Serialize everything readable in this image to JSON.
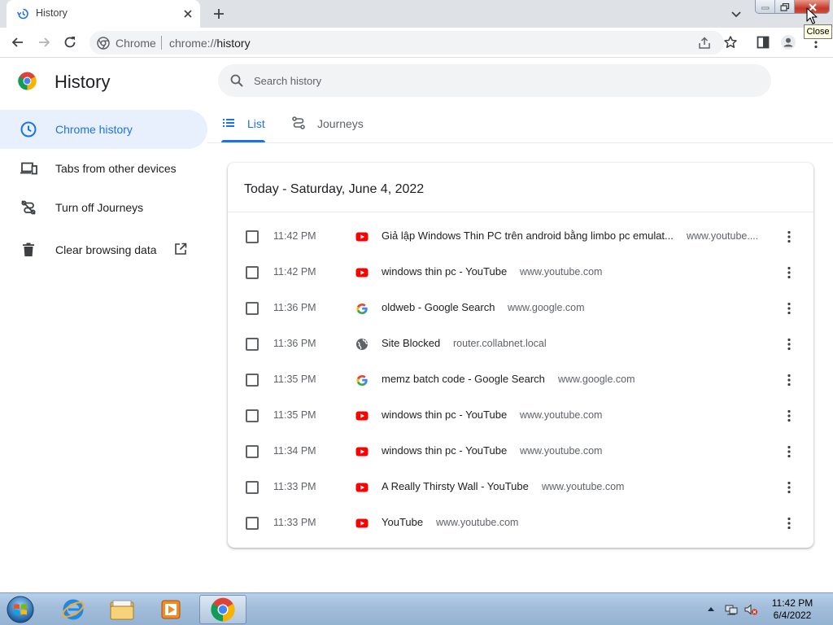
{
  "browser": {
    "tab_title": "History",
    "tooltip": "Close",
    "omnibox": {
      "site_label": "Chrome",
      "url_scheme": "chrome://",
      "url_path": "history"
    }
  },
  "page": {
    "title": "History",
    "search_placeholder": "Search history"
  },
  "sidebar": {
    "items": [
      {
        "label": "Chrome history",
        "icon": "clock-icon",
        "active": true
      },
      {
        "label": "Tabs from other devices",
        "icon": "devices-icon",
        "active": false
      },
      {
        "label": "Turn off Journeys",
        "icon": "journeys-off-icon",
        "active": false
      },
      {
        "label": "Clear browsing data",
        "icon": "trash-icon",
        "active": false
      }
    ]
  },
  "tabs": [
    {
      "label": "List",
      "icon": "list-icon",
      "active": true
    },
    {
      "label": "Journeys",
      "icon": "journeys-icon",
      "active": false
    }
  ],
  "history": {
    "date_header": "Today - Saturday, June 4, 2022",
    "entries": [
      {
        "time": "11:42 PM",
        "title": "Giả lập Windows Thin PC trên android bằng limbo pc emulat...",
        "domain": "www.youtube....",
        "favicon": "youtube-icon"
      },
      {
        "time": "11:42 PM",
        "title": "windows thin pc - YouTube",
        "domain": "www.youtube.com",
        "favicon": "youtube-icon"
      },
      {
        "time": "11:36 PM",
        "title": "oldweb - Google Search",
        "domain": "www.google.com",
        "favicon": "google-icon"
      },
      {
        "time": "11:36 PM",
        "title": "Site Blocked",
        "domain": "router.collabnet.local",
        "favicon": "globe-icon"
      },
      {
        "time": "11:35 PM",
        "title": "memz batch code - Google Search",
        "domain": "www.google.com",
        "favicon": "google-icon"
      },
      {
        "time": "11:35 PM",
        "title": "windows thin pc - YouTube",
        "domain": "www.youtube.com",
        "favicon": "youtube-icon"
      },
      {
        "time": "11:34 PM",
        "title": "windows thin pc - YouTube",
        "domain": "www.youtube.com",
        "favicon": "youtube-icon"
      },
      {
        "time": "11:33 PM",
        "title": "A Really Thirsty Wall - YouTube",
        "domain": "www.youtube.com",
        "favicon": "youtube-icon"
      },
      {
        "time": "11:33 PM",
        "title": "YouTube",
        "domain": "www.youtube.com",
        "favicon": "youtube-icon"
      }
    ]
  },
  "taskbar": {
    "clock_time": "11:42 PM",
    "clock_date": "6/4/2022"
  },
  "colors": {
    "accent": "#1a73e8",
    "active_bg": "#e8f0fe",
    "youtube": "#ff0000"
  }
}
